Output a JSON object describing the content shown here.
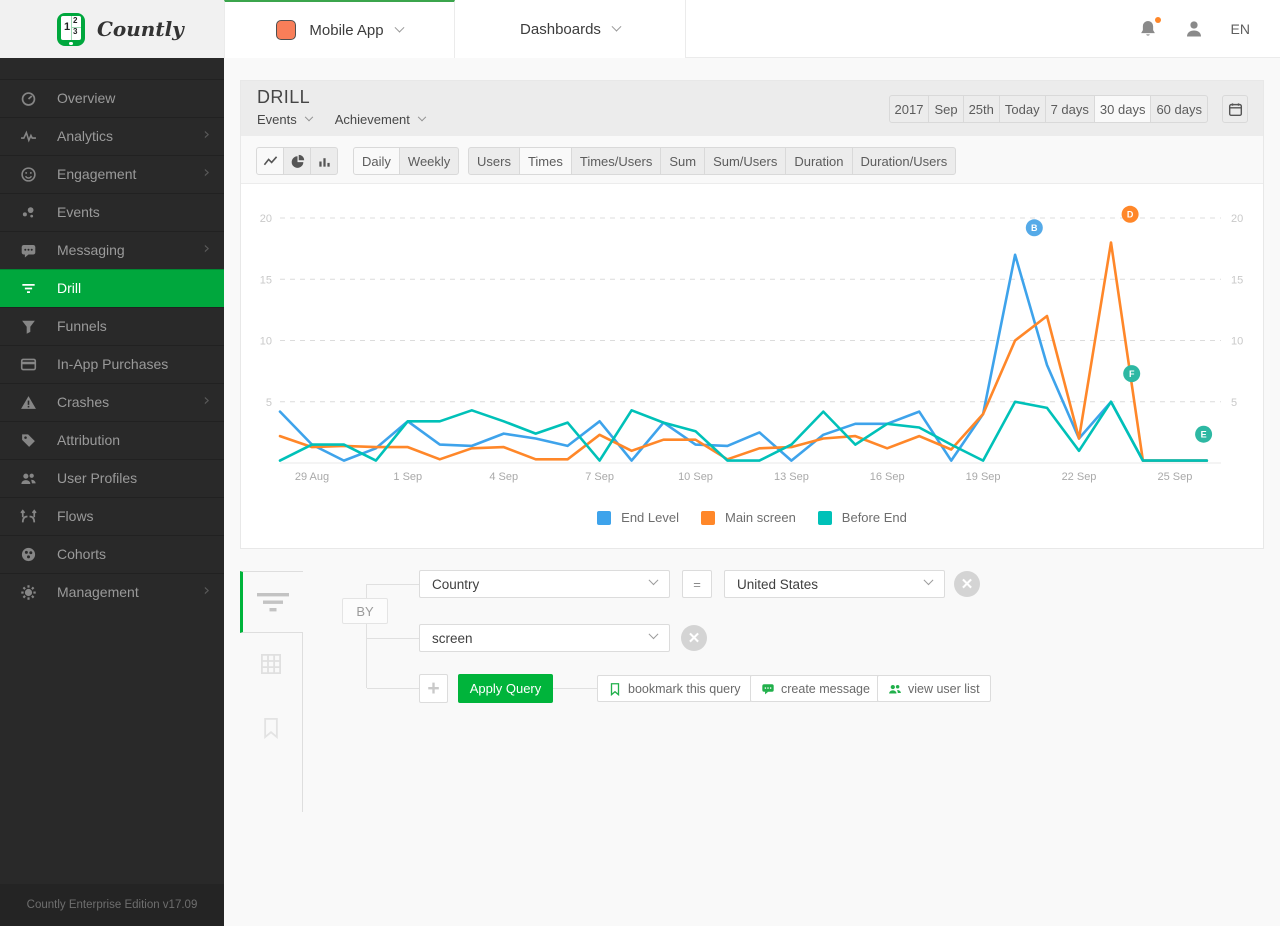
{
  "brand": {
    "logo_text": "Countly",
    "footer_text": "Countly Enterprise Edition v17.09",
    "accent_color": "#00a73d"
  },
  "topbar": {
    "app_selector": {
      "label": "Mobile App",
      "icon_color": "#ff7b55"
    },
    "dashboards_label": "Dashboards",
    "language": "EN",
    "notification_dot_color": "#ff8729"
  },
  "sidebar": {
    "items": [
      {
        "label": "Overview",
        "icon": "gauge",
        "submenu": false,
        "active": false
      },
      {
        "label": "Analytics",
        "icon": "pulse",
        "submenu": true,
        "active": false
      },
      {
        "label": "Engagement",
        "icon": "smiley",
        "submenu": true,
        "active": false
      },
      {
        "label": "Events",
        "icon": "dots",
        "submenu": false,
        "active": false
      },
      {
        "label": "Messaging",
        "icon": "chat",
        "submenu": true,
        "active": false
      },
      {
        "label": "Drill",
        "icon": "filter",
        "submenu": false,
        "active": true
      },
      {
        "label": "Funnels",
        "icon": "funnel",
        "submenu": false,
        "active": false
      },
      {
        "label": "In-App Purchases",
        "icon": "creditcard",
        "submenu": false,
        "active": false
      },
      {
        "label": "Crashes",
        "icon": "warning",
        "submenu": true,
        "active": false
      },
      {
        "label": "Attribution",
        "icon": "tag",
        "submenu": false,
        "active": false
      },
      {
        "label": "User Profiles",
        "icon": "people",
        "submenu": false,
        "active": false
      },
      {
        "label": "Flows",
        "icon": "shuffle",
        "submenu": false,
        "active": false
      },
      {
        "label": "Cohorts",
        "icon": "piedots",
        "submenu": false,
        "active": false
      },
      {
        "label": "Management",
        "icon": "gear",
        "submenu": true,
        "active": false
      }
    ]
  },
  "panel": {
    "title": "DRILL",
    "selector1": "Events",
    "selector2": "Achievement",
    "dates": {
      "buttons": [
        "2017",
        "Sep",
        "25th",
        "Today",
        "7 days",
        "30 days",
        "60 days"
      ],
      "active": "30 days"
    },
    "chart_types": {
      "buttons": [
        "line-chart",
        "pie-chart",
        "bar-chart"
      ],
      "active": "line-chart"
    },
    "period": {
      "buttons": [
        "Daily",
        "Weekly"
      ],
      "active": "Daily"
    },
    "metrics": {
      "buttons": [
        "Users",
        "Times",
        "Times/Users",
        "Sum",
        "Sum/Users",
        "Duration",
        "Duration/Users"
      ],
      "active": "Times"
    }
  },
  "chart_data": {
    "type": "line",
    "x": [
      "28 Aug",
      "29 Aug",
      "30 Aug",
      "31 Aug",
      "1 Sep",
      "2 Sep",
      "3 Sep",
      "4 Sep",
      "5 Sep",
      "6 Sep",
      "7 Sep",
      "8 Sep",
      "9 Sep",
      "10 Sep",
      "11 Sep",
      "12 Sep",
      "13 Sep",
      "14 Sep",
      "15 Sep",
      "16 Sep",
      "17 Sep",
      "18 Sep",
      "19 Sep",
      "20 Sep",
      "21 Sep",
      "22 Sep",
      "23 Sep",
      "24 Sep",
      "25 Sep",
      "26 Sep"
    ],
    "tick_labels": [
      "29 Aug",
      "1 Sep",
      "4 Sep",
      "7 Sep",
      "10 Sep",
      "13 Sep",
      "16 Sep",
      "19 Sep",
      "22 Sep",
      "25 Sep"
    ],
    "tick_indices": [
      1,
      4,
      7,
      10,
      13,
      16,
      19,
      22,
      25,
      28
    ],
    "ylim": [
      0,
      20
    ],
    "yticks": [
      5,
      10,
      15,
      20
    ],
    "grid": true,
    "legend_position": "bottom",
    "series": [
      {
        "name": "End Level",
        "color": "#3ea3eb",
        "values": [
          4.2,
          1.5,
          0.2,
          1.2,
          3.4,
          1.5,
          1.4,
          2.4,
          2.0,
          1.4,
          3.4,
          0.2,
          3.3,
          1.5,
          1.4,
          2.5,
          0.2,
          2.3,
          3.2,
          3.2,
          4.2,
          0.2,
          4.0,
          17,
          8,
          2,
          5,
          0.2,
          0.2,
          0.2
        ]
      },
      {
        "name": "Main screen",
        "color": "#ff8729",
        "values": [
          2.2,
          1.3,
          1.4,
          1.3,
          1.3,
          0.3,
          1.2,
          1.3,
          0.3,
          0.3,
          2.3,
          1.0,
          1.9,
          1.9,
          0.3,
          1.2,
          1.3,
          2.0,
          2.2,
          1.2,
          2.2,
          1.1,
          4.0,
          10,
          12,
          2,
          18,
          0.2,
          0.2,
          0.2
        ]
      },
      {
        "name": "Before End",
        "color": "#00c1b8",
        "values": [
          0.2,
          1.5,
          1.5,
          0.2,
          3.4,
          3.4,
          4.3,
          3.4,
          2.4,
          3.3,
          0.2,
          4.3,
          3.3,
          2.6,
          0.2,
          0.2,
          1.5,
          4.2,
          1.5,
          3.2,
          2.9,
          1.5,
          0.2,
          5,
          4.5,
          1,
          5,
          0.2,
          0.2,
          0.2
        ]
      }
    ],
    "markers": [
      {
        "label": "B",
        "color": "#55aae8",
        "x": "20 Sep",
        "value": 19.2,
        "x_offset": 0.6
      },
      {
        "label": "D",
        "color": "#ff8729",
        "x": "23 Sep",
        "value": 20.3,
        "x_offset": 0.6
      },
      {
        "label": "F",
        "color": "#2db8a3",
        "x": "23 Sep",
        "value": 7.3,
        "x_offset": 0.65
      },
      {
        "label": "E",
        "color": "#2db8a3",
        "x": "26 Sep",
        "value": 2.35,
        "x_offset": -0.1
      }
    ]
  },
  "query": {
    "by_label": "BY",
    "filter_row": {
      "field": "Country",
      "operator": "=",
      "value": "United States"
    },
    "group_row": {
      "field": "screen"
    },
    "apply_label": "Apply Query",
    "actions": [
      {
        "label": "bookmark this query",
        "icon": "bookmark"
      },
      {
        "label": "create message",
        "icon": "message"
      },
      {
        "label": "view user list",
        "icon": "people"
      }
    ]
  }
}
